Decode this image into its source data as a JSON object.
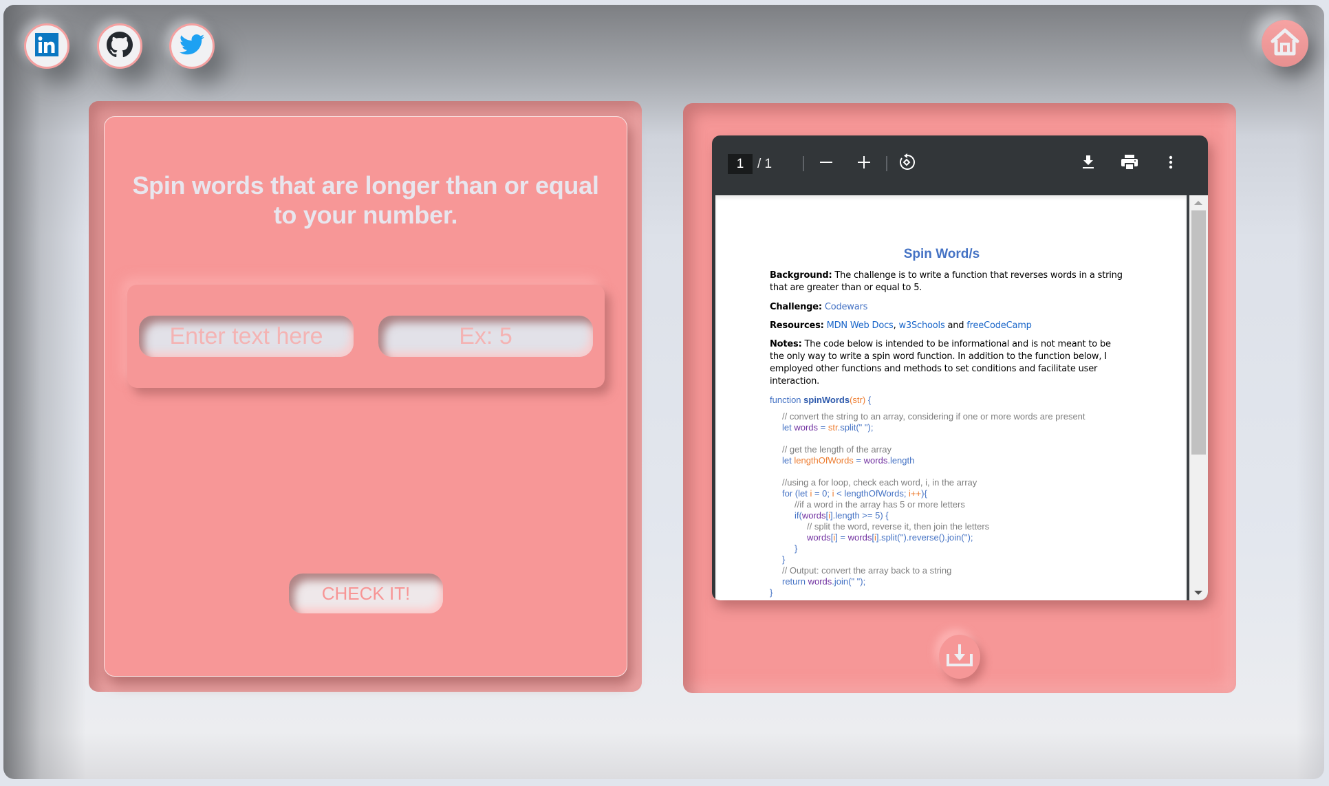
{
  "social": [
    {
      "name": "linkedin",
      "icon": "linkedin-icon",
      "color": "#0a66c2"
    },
    {
      "name": "github",
      "icon": "github-icon",
      "color": "#24292f"
    },
    {
      "name": "twitter",
      "icon": "twitter-icon",
      "color": "#1da1f2"
    }
  ],
  "home": {
    "icon": "home-icon"
  },
  "challenge": {
    "title": "Spin words that are longer than or equal to your number.",
    "text_input_placeholder": "Enter text here",
    "number_input_placeholder": "Ex: 5",
    "check_button_label": "CHECK IT!"
  },
  "pdf_viewer": {
    "current_page": "1",
    "page_total": "/ 1",
    "toolbar_icons": [
      "zoom-out-icon",
      "zoom-in-icon",
      "rotate-icon",
      "download-icon",
      "print-icon",
      "more-options-icon"
    ],
    "document": {
      "title": "Spin Word/s",
      "background_label": "Background:",
      "background_text": " The challenge is to write a function that reverses words in a string that are greater than or equal to 5.",
      "challenge_label": "Challenge:",
      "challenge_link": "Codewars",
      "resources_label": "Resources:",
      "resources_link_1": "MDN Web Docs",
      "resources_sep": ", ",
      "resources_link_2": "w3Schools",
      "resources_and": " and ",
      "resources_link_3": "freeCodeCamp",
      "notes_label": "Notes:",
      "notes_text": " The code below is intended to be informational and is not meant to be the only way to write a spin word function. In addition to the function below, I employed other functions and methods to set conditions and facilitate user interaction.",
      "code": [
        {
          "indent": 0,
          "parts": [
            [
              "kw",
              "function "
            ],
            [
              "fn",
              "spinWords"
            ],
            [
              "arg",
              "(str)"
            ],
            [
              "kw",
              " {"
            ]
          ]
        },
        {
          "indent": 1,
          "parts": [
            [
              "cm",
              "// convert the string to an array, considering if one or more words are present"
            ]
          ]
        },
        {
          "indent": 1,
          "parts": [
            [
              "kw",
              "let "
            ],
            [
              "var",
              "words"
            ],
            [
              "kw",
              " = "
            ],
            [
              "arg",
              "str"
            ],
            [
              "kw",
              ".split(\" \");"
            ]
          ]
        },
        {
          "indent": 1,
          "parts": [
            [
              "cm",
              ""
            ]
          ]
        },
        {
          "indent": 1,
          "parts": [
            [
              "cm",
              "// get the length of the array"
            ]
          ]
        },
        {
          "indent": 1,
          "parts": [
            [
              "kw",
              "let "
            ],
            [
              "arg",
              "lengthOfWords"
            ],
            [
              "kw",
              " = "
            ],
            [
              "var",
              "words"
            ],
            [
              "kw",
              ".length"
            ]
          ]
        },
        {
          "indent": 1,
          "parts": [
            [
              "cm",
              ""
            ]
          ]
        },
        {
          "indent": 1,
          "parts": [
            [
              "cm",
              "//using a for loop, check each word, i, in the array"
            ]
          ]
        },
        {
          "indent": 1,
          "parts": [
            [
              "kw",
              "for (let "
            ],
            [
              "arg",
              "i"
            ],
            [
              "kw",
              " = 0; "
            ],
            [
              "arg",
              "i"
            ],
            [
              "kw",
              " < lengthOfWords; "
            ],
            [
              "arg",
              "i++"
            ],
            [
              "kw",
              "){"
            ]
          ]
        },
        {
          "indent": 2,
          "parts": [
            [
              "cm",
              "//if a word in the array has 5 or more letters"
            ]
          ]
        },
        {
          "indent": 2,
          "parts": [
            [
              "kw",
              "if("
            ],
            [
              "var",
              "words"
            ],
            [
              "kw",
              "["
            ],
            [
              "arg",
              "i"
            ],
            [
              "kw",
              "].length >= 5) {"
            ]
          ]
        },
        {
          "indent": 3,
          "parts": [
            [
              "cm",
              "// split the word, reverse it, then join the letters"
            ]
          ]
        },
        {
          "indent": 3,
          "parts": [
            [
              "var",
              "words"
            ],
            [
              "kw",
              "["
            ],
            [
              "arg",
              "i"
            ],
            [
              "kw",
              "] = "
            ],
            [
              "var",
              "words"
            ],
            [
              "kw",
              "["
            ],
            [
              "arg",
              "i"
            ],
            [
              "kw",
              "].split('').reverse().join('');"
            ]
          ]
        },
        {
          "indent": 2,
          "parts": [
            [
              "kw",
              "}"
            ]
          ]
        },
        {
          "indent": 1,
          "parts": [
            [
              "kw",
              "}"
            ]
          ]
        },
        {
          "indent": 1,
          "parts": [
            [
              "cm",
              "// Output: convert the array back to a string"
            ]
          ]
        },
        {
          "indent": 1,
          "parts": [
            [
              "kw",
              "return "
            ],
            [
              "var",
              "words"
            ],
            [
              "kw",
              ".join(\" \");"
            ]
          ]
        },
        {
          "indent": 0,
          "parts": [
            [
              "kw",
              "}"
            ]
          ]
        }
      ]
    },
    "scroll_position": 0.0
  },
  "download_button": {
    "icon": "download-tray-icon"
  },
  "colors": {
    "accent": "#f79797",
    "panel_shadow": "#e59a9a",
    "pdf_toolbar": "#323639",
    "link": "#4472c4"
  }
}
